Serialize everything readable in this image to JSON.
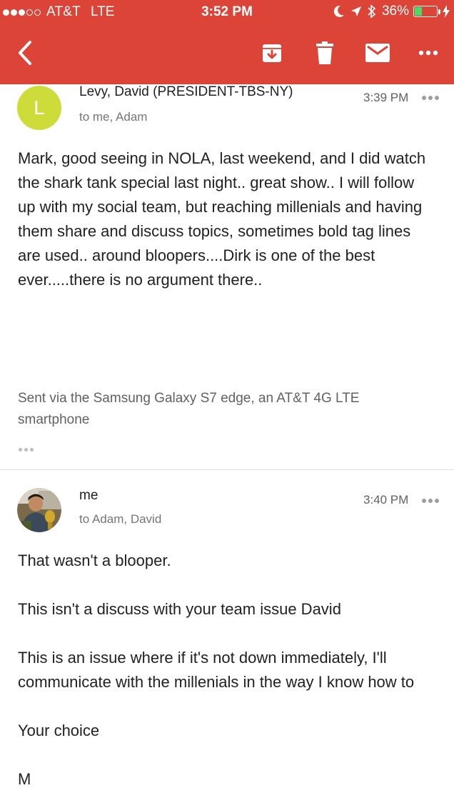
{
  "status_bar": {
    "carrier": "AT&T",
    "network": "LTE",
    "time": "3:52 PM",
    "battery_percent": "36%",
    "battery_level": 0.36,
    "icons": [
      "moon-icon",
      "location-arrow-icon",
      "bluetooth-icon",
      "battery-icon",
      "charging-icon"
    ]
  },
  "toolbar": {
    "icons": [
      "back-arrow-icon",
      "archive-icon",
      "trash-icon",
      "mail-icon",
      "more-icon"
    ]
  },
  "colors": {
    "toolbar_bg": "#db4437",
    "avatar_l_bg": "#cddc39",
    "battery_fill": "#4cd964"
  },
  "messages": [
    {
      "avatar_letter": "L",
      "sender": "Levy, David (PRESIDENT-TBS-NY)",
      "recipients": "to me, Adam",
      "time": "3:39 PM",
      "body": "Mark, good seeing in NOLA, last weekend,  and I did watch the shark tank special last night.. great show.. I will follow up with my social team, but reaching millenials and having them share and discuss topics, sometimes bold tag lines are used.. around bloopers....Dirk is one of the best ever.....there is no argument there..",
      "signature": "Sent via the Samsung Galaxy S7 edge, an AT&T 4G LTE smartphone"
    },
    {
      "sender": "me",
      "recipients": "to Adam, David",
      "time": "3:40 PM",
      "paragraphs": [
        "That wasn't a blooper.",
        "This isn't a discuss with your team issue David",
        "This is an issue where if it's not down immediately, I'll communicate with the millenials in the way I know how to",
        "Your choice",
        "M"
      ]
    }
  ]
}
